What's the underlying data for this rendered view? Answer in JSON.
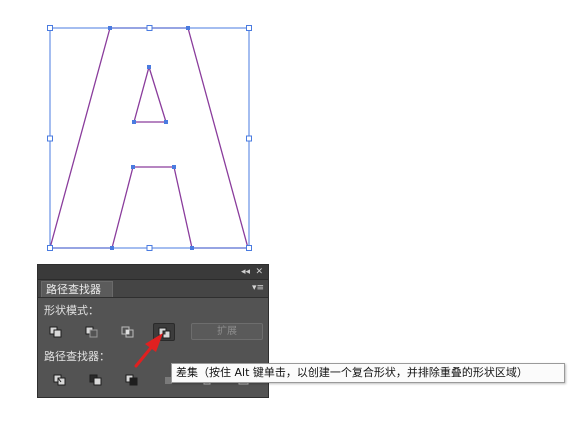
{
  "panel": {
    "title": "路径查找器",
    "collapse_glyph": "◂◂",
    "close_glyph": "✕",
    "menu_glyph": "▾≡",
    "shape_modes_label": "形状模式：",
    "pathfinders_label": "路径查找器：",
    "expand_label": "扩展",
    "shape_mode_icons": [
      "unite-icon",
      "minus-front-icon",
      "intersect-icon",
      "exclude-icon"
    ],
    "pathfinder_icons": [
      "divide-icon",
      "trim-icon",
      "merge-icon",
      "crop-icon",
      "outline-icon",
      "minus-back-icon"
    ]
  },
  "tooltip": {
    "text": "差集（按住 Alt 键单击，以创建一个复合形状，并排除重叠的形状区域）"
  },
  "colors": {
    "selection_blue": "#4a7be0",
    "path_purple": "#8a3c9c",
    "arrow_red": "#e02020",
    "panel_bg": "#535353"
  }
}
